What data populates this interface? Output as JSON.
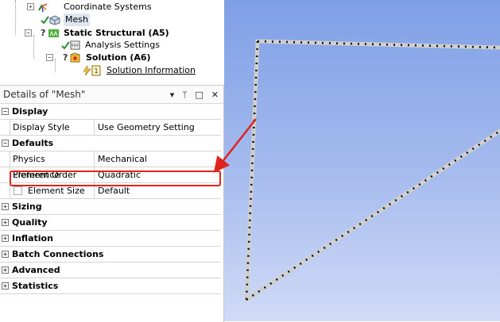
{
  "tree": {
    "items": [
      {
        "label": "Coordinate Systems"
      },
      {
        "label": "Mesh"
      },
      {
        "label": "Static Structural (A5)"
      },
      {
        "label": "Analysis Settings"
      },
      {
        "label": "Solution (A6)"
      },
      {
        "label": "Solution Information"
      }
    ],
    "status_mark": "?"
  },
  "details": {
    "title": "Details of \"Mesh\"",
    "controls": {
      "dropdown": "▾",
      "pin": "ᛘ",
      "maximize": "□",
      "close": "✕"
    },
    "sections": {
      "display": {
        "label": "Display"
      },
      "defaults": {
        "label": "Defaults"
      },
      "sizing": {
        "label": "Sizing"
      },
      "quality": {
        "label": "Quality"
      },
      "inflation": {
        "label": "Inflation"
      },
      "batch": {
        "label": "Batch Connections"
      },
      "advanced": {
        "label": "Advanced"
      },
      "statistics": {
        "label": "Statistics"
      }
    },
    "rows": {
      "display_style": {
        "name": "Display Style",
        "value": "Use Geometry Setting"
      },
      "physics_preference": {
        "name": "Physics Preference",
        "value": "Mechanical"
      },
      "element_order": {
        "name": "Element Order",
        "value": "Quadratic"
      },
      "element_size": {
        "name": "Element Size",
        "value": "Default"
      }
    },
    "expand_symbol": "+",
    "collapse_symbol": "−"
  },
  "colors": {
    "highlight": "#e0231c",
    "arrow": "#e0231c",
    "viewport_top": "#7f9fe6",
    "viewport_bottom": "#d0dbf6"
  }
}
